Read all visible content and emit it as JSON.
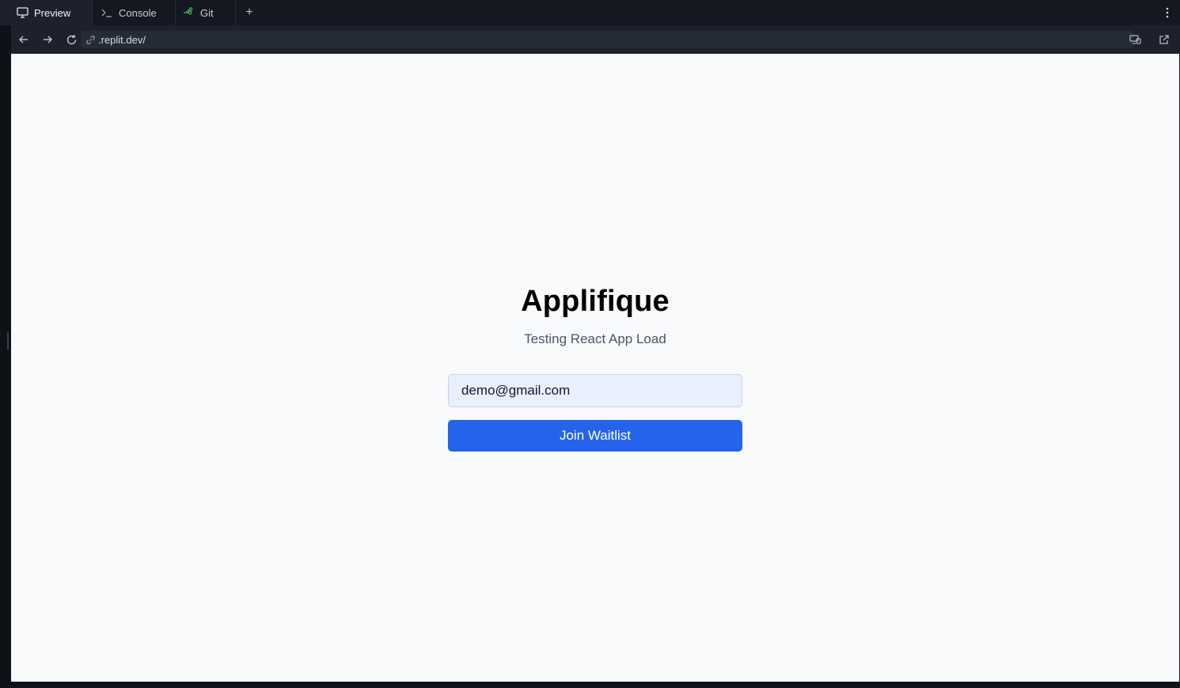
{
  "tabs": [
    {
      "label": "Preview",
      "icon": "monitor-icon",
      "active": true
    },
    {
      "label": "Console",
      "icon": "terminal-icon",
      "active": false
    },
    {
      "label": "Git",
      "icon": "git-branch-icon",
      "active": false
    }
  ],
  "add_tab_label": "+",
  "address_bar": {
    "url": ".replit.dev/"
  },
  "app": {
    "title": "Applifique",
    "subtitle": "Testing React App Load",
    "email_value": "demo@gmail.com",
    "join_label": "Join Waitlist"
  },
  "colors": {
    "accent": "#2563eb",
    "input_bg": "#e8f0fe",
    "page_bg": "#f8fafc",
    "chrome_bg": "#141820",
    "git_icon": "#3fb950"
  }
}
